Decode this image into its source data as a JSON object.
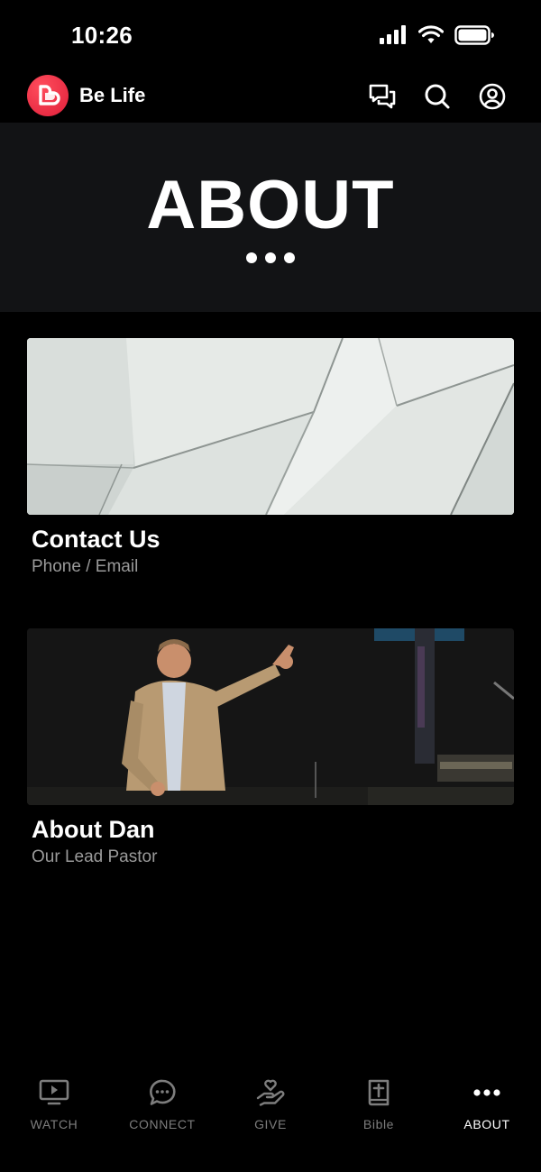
{
  "status_bar": {
    "time": "10:26"
  },
  "header": {
    "app_name": "Be Life",
    "brand_color": "#e8263f"
  },
  "hero": {
    "title": "ABOUT"
  },
  "cards": [
    {
      "title": "Contact Us",
      "subtitle": "Phone / Email",
      "image": "paper-abstract"
    },
    {
      "title": "About Dan",
      "subtitle": "Our Lead Pastor",
      "image": "pastor-on-stage"
    }
  ],
  "tabs": [
    {
      "label": "WATCH",
      "icon": "tv-play-icon",
      "active": false
    },
    {
      "label": "CONNECT",
      "icon": "chat-bubble-icon",
      "active": false
    },
    {
      "label": "GIVE",
      "icon": "hand-heart-icon",
      "active": false
    },
    {
      "label": "Bible",
      "icon": "bible-icon",
      "active": false
    },
    {
      "label": "ABOUT",
      "icon": "more-dots-icon",
      "active": true
    }
  ]
}
